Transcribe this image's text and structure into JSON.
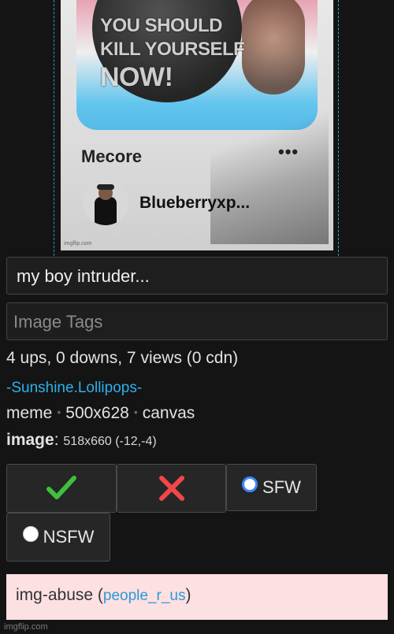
{
  "meme": {
    "overlay_text_lines": [
      "YOU SHOULD",
      "KILL YOURSELF",
      "NOW!"
    ],
    "username_top": "Mecore",
    "more_dots": "•••",
    "username_bottom": "Blueberryxp...",
    "watermark_small": "imgflip.com"
  },
  "form": {
    "title_value": "my boy intruder...",
    "tags_placeholder": "Image Tags"
  },
  "info": {
    "stats": "4 ups, 0 downs, 7 views (0 cdn)",
    "uploader": "-Sunshine.Lollipops-",
    "meta_items": [
      "meme",
      "500x628",
      "canvas"
    ],
    "meta_separator": "•",
    "image_label": "image",
    "image_colon": ":",
    "image_details": "518x660 (-12,-4)"
  },
  "actions": {
    "upvote_glyph": "✔",
    "downvote_glyph": "✖",
    "sfw_label": "SFW",
    "nsfw_label": "NSFW",
    "sfw_selected": true,
    "colors": {
      "check": "#3fbf3f",
      "cross": "#f0474a",
      "radio_on": "#3a86ff"
    }
  },
  "abuse": {
    "prefix": "img-abuse (",
    "link": "people_r_us",
    "suffix": ")"
  },
  "footer": {
    "watermark": "imgflip.com"
  }
}
